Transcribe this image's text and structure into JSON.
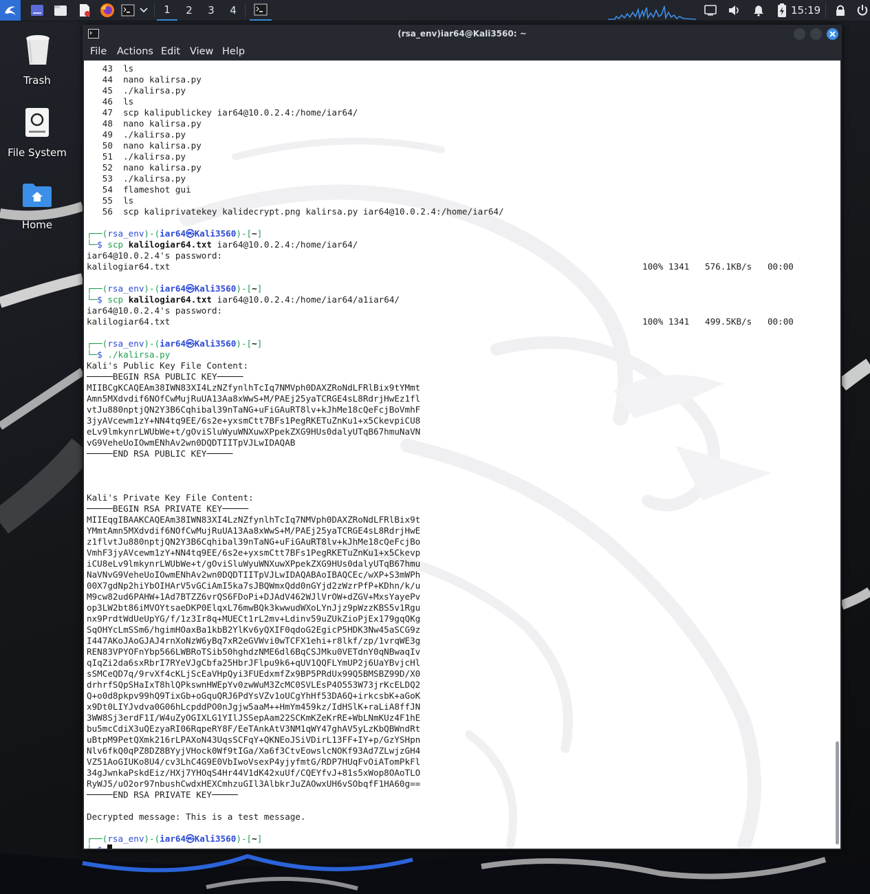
{
  "panel": {
    "workspaces": [
      "1",
      "2",
      "3",
      "4"
    ],
    "active_workspace": "1",
    "clock": "15:19",
    "icons": [
      "kali-menu-icon",
      "workspace-switcher-icon",
      "file-manager-icon",
      "text-editor-icon",
      "firefox-icon",
      "terminal-icon",
      "chevron-down-icon",
      "terminal-task-icon",
      "network-graph-icon",
      "display-icon",
      "volume-icon",
      "notification-bell-icon",
      "battery-charging-icon",
      "lock-icon",
      "power-icon"
    ]
  },
  "desktop": {
    "trash": "Trash",
    "filesystem": "File System",
    "home": "Home"
  },
  "window": {
    "title": "(rsa_env)iar64@Kali3560: ~",
    "menu": [
      "File",
      "Actions",
      "Edit",
      "View",
      "Help"
    ]
  },
  "terminal": {
    "history": [
      {
        "n": "43",
        "cmd": "ls"
      },
      {
        "n": "44",
        "cmd": "nano kalirsa.py"
      },
      {
        "n": "45",
        "cmd": "./kalirsa.py"
      },
      {
        "n": "46",
        "cmd": "ls"
      },
      {
        "n": "47",
        "cmd": "scp kalipublickey iar64@10.0.2.4:/home/iar64/"
      },
      {
        "n": "48",
        "cmd": "nano kalirsa.py"
      },
      {
        "n": "49",
        "cmd": "./kalirsa.py"
      },
      {
        "n": "50",
        "cmd": "nano kalirsa.py"
      },
      {
        "n": "51",
        "cmd": "./kalirsa.py"
      },
      {
        "n": "52",
        "cmd": "nano kalirsa.py"
      },
      {
        "n": "53",
        "cmd": "./kalirsa.py"
      },
      {
        "n": "54",
        "cmd": "flameshot gui"
      },
      {
        "n": "55",
        "cmd": "ls"
      },
      {
        "n": "56",
        "cmd": "scp kaliprivatekey kalidecrypt.png kalirsa.py iar64@10.0.2.4:/home/iar64/"
      }
    ],
    "prompt": {
      "open": "┌──(",
      "env": "rsa_env",
      "mid": ")-(",
      "user": "iar64",
      "at": "㉿",
      "host": "Kali3560",
      "close": ")-[",
      "dir": "~",
      "end": "]",
      "second": "└─",
      "dollar": "$"
    },
    "scp1": {
      "cmd": "scp",
      "file": "kalilogiar64.txt",
      "dest": " iar64@10.0.2.4:/home/iar64/",
      "password": "iar64@10.0.2.4's password:",
      "out_file": "kalilogiar64.txt",
      "progress": "100% 1341   576.1KB/s   00:00"
    },
    "scp2": {
      "cmd": "scp",
      "file": "kalilogiar64.txt",
      "dest": " iar64@10.0.2.4:/home/iar64/a1iar64/",
      "password": "iar64@10.0.2.4's password:",
      "out_file": "kalilogiar64.txt",
      "progress": "100% 1341   499.5KB/s   00:00"
    },
    "run_cmd": "./kalirsa.py",
    "public_header": "Kali's Public Key File Content:",
    "public_key": [
      "─────BEGIN RSA PUBLIC KEY─────",
      "MIIBCgKCAQEAm38IWN83XI4LzNZfynlhTcIq7NMVph0DAXZRoNdLFRlBix9tYMmt",
      "Amn5MXdvdif6NOfCwMujRuUA13Aa8xWwS+M/PAEj25yaTCRGE4sL8RdrjHwEz1fl",
      "vtJu880nptjQN2Y3B6Cqhibal39nTaNG+uFiGAuRT8lv+kJhMe18cQeFcjBoVmhF",
      "3jyAVcewm1zY+NN4tq9EE/6s2e+yxsmCtt7BFs1PegRKETuZnKu1+x5CkevpiCU8",
      "eLv9lmkynrLWUbWe+t/gOviSluWyuWNXuwXPpekZXG9HUs0dalyUTqB67hmuNaVN",
      "vG9VeheUoIOwmENhAv2wn0DQDTIITpVJLwIDAQAB",
      "─────END RSA PUBLIC KEY─────"
    ],
    "private_header": "Kali's Private Key File Content:",
    "private_key": [
      "─────BEGIN RSA PRIVATE KEY─────",
      "MIIEqgIBAAKCAQEAm38IWN83XI4LzNZfynlhTcIq7NMVph0DAXZRoNdLFRlBix9t",
      "YMmtAmn5MXdvdif6NOfCwMujRuUA13Aa8xWwS+M/PAEj25yaTCRGE4sL8RdrjHwE",
      "z1flvtJu880nptjQN2Y3B6Cqhibal39nTaNG+uFiGAuRT8lv+kJhMe18cQeFcjBo",
      "VmhF3jyAVcewm1zY+NN4tq9EE/6s2e+yxsmCtt7BFs1PegRKETuZnKu1+x5Ckevp",
      "iCU8eLv9lmkynrLWUbWe+t/gOviSluWyuWNXuwXPpekZXG9HUs0dalyUTqB67hmu",
      "NaVNvG9VeheUoIOwmENhAv2wn0DQDTIITpVJLwIDAQABAoIBAQCEc/wXP+S3mWPh",
      "00X7gdNp2hiYbOIHArV5vGCiAmI5ka7sJBQWmxQdd0nGYjd2zWzrPfP+KDhn/k/u",
      "M9cw82ud6PAHW+1Ad7BTZZ6vrQS6FDoPi+DJAdV462WJlVrOW+dZGV+MxsYayePv",
      "op3LW2bt86iMVOYtsaeDKP0ElqxL76mwBQk3kwwudWXoLYnJjz9pWzzKBS5v1Rgu",
      "nx9PrdtWdUeUpYG/f/1z3Ir8q+MUECt1rL2mv+Ldinv59uZUkZioPjEx179gqQKg",
      "SqOHYcLmSSm6/hgimHOaxBa1kbB2YlKv6yQXIF0qdoG2EgicP5HDK3Nw45aSCG9z",
      "I447AKoJAoGJAJ4rnXoNzW6yBq7xR2eGVWvi0wTCFX1ehi+r8lkf/zp/1vrqWE3g",
      "REN83VPYOFnYbp566LWBRoTSib50hghdzNME6dl6BqCSJMku0VETdnY0qNBwaqIv",
      "qIqZi2da6sxRbrI7RYeVJgCbfa25HbrJFlpu9k6+qUV1QQFLYmUP2j6UaYBvjcHl",
      "sSMCeQD7q/9rvXf4cKLjScEaVHpQyi3FUEdxmfZx9BP5PRdUx99Q5BMSBZ99D/X0",
      "drhrfSQpSHaIxT8hlQPkswnHWEpYv0zwWuM3ZcMC0SVLEsP4O553W73jrKcELDQ2",
      "Q+o0d8pkpv99hQ9TixGb+oGquQRJ6PdYsVZv1oUCgYhHf53DA6Q+irkcsbK+aGoK",
      "x9Dt0LIYJvdva0G06hLcpddPO0nJgjw5aaM++HmYm459kz/IdHSlK+raLiA8ffJN",
      "3WW8Sj3erdF1I/W4uZyOGIXLG1YIlJSSepAam22SCKmKZeKrRE+WbLNmKUz4F1hE",
      "bu5mcCdiX3uQEzyaRI06RqpeRY8F/EeTAnkAtV3NM1qWY47ghAV5yLzKbQBWndRt",
      "uBtpM9PetQXmk216rLPAXoN43UqsSCFqY+QKNEoJSiVDirL13FF+IY+p/GzYSHpn",
      "Nlv6fkQ0qPZ8DZ8BYyjVHock0Wf9tIGa/Xa6f3CtvEowslcNOKf93Ad7ZLwjzGH4",
      "VZ51AoGIUKo8U4/cv3LhC4G9E0VbIwoVsexP4yjyfmtG/RDP7HUqFvOiATomPkFl",
      "34gJwnkaPskdEiz/HXj7YHOqS4Hr44V1dK42xuUf/CQEYfvJ+81s5xWop8OAoTLO",
      "RyWJ5/uO2or97nbushCwdxHEXCmhzuGIl3AlbkrJuZAOwxUH6vSObqfF1HA60g==",
      "─────END RSA PRIVATE KEY─────"
    ],
    "decrypted": "Decrypted message: This is a test message."
  }
}
